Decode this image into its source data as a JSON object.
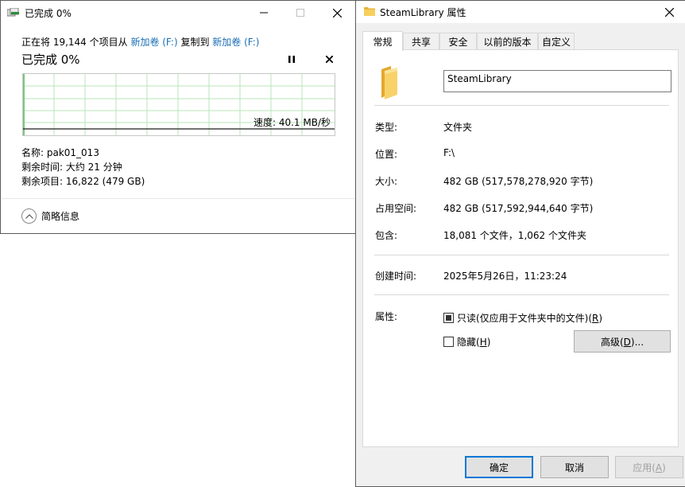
{
  "copy_dialog": {
    "title": "已完成 0%",
    "desc_prefix": "正在将 19,144 个项目从 ",
    "source": "新加卷 (F:)",
    "desc_mid": " 复制到 ",
    "dest": "新加卷 (F:)",
    "percent_label": "已完成 0%",
    "progress": 0,
    "speed_label": "速度: 40.1 MB/秒",
    "name_label": "名称: pak01_013",
    "time_label": "剩余时间: 大约 21 分钟",
    "items_label": "剩余项目: 16,822 (479 GB)",
    "details_toggle": "简略信息",
    "icons": {
      "title": "copy-icon",
      "pause": "pause-icon",
      "cancel": "close-icon",
      "chevron": "chevron-up-icon"
    },
    "colors": {
      "graph_grid": "#b9e6b9",
      "graph_line": "#1e1e1e",
      "link": "#1a6fb5"
    }
  },
  "properties": {
    "title": "SteamLibrary 属性",
    "tabs": [
      "常规",
      "共享",
      "安全",
      "以前的版本",
      "自定义"
    ],
    "active_tab": "常规",
    "name_value": "SteamLibrary",
    "fields": [
      {
        "label": "类型:",
        "value": "文件夹"
      },
      {
        "label": "位置:",
        "value": "F:\\"
      },
      {
        "label": "大小:",
        "value": "482 GB (517,578,278,920 字节)"
      },
      {
        "label": "占用空间:",
        "value": "482 GB (517,592,944,640 字节)"
      },
      {
        "label": "包含:",
        "value": "18,081 个文件，1,062 个文件夹"
      }
    ],
    "created_label": "创建时间:",
    "created_value": "2025年5月26日，11:23:24",
    "attributes_label": "属性:",
    "readonly": {
      "prefix": "只读(仅应用于文件夹中的文件)(",
      "key": "R",
      "suffix": ")",
      "state": "indeterminate"
    },
    "hidden": {
      "prefix": "隐藏(",
      "key": "H",
      "suffix": ")",
      "state": "unchecked"
    },
    "advanced": {
      "prefix": "高级(",
      "key": "D",
      "suffix": ")..."
    },
    "ok": "确定",
    "cancel": "取消",
    "apply": {
      "prefix": "应用(",
      "key": "A",
      "suffix": ")"
    },
    "icons": {
      "title": "folder-icon",
      "folder": "folder-icon",
      "close": "close-icon"
    }
  }
}
